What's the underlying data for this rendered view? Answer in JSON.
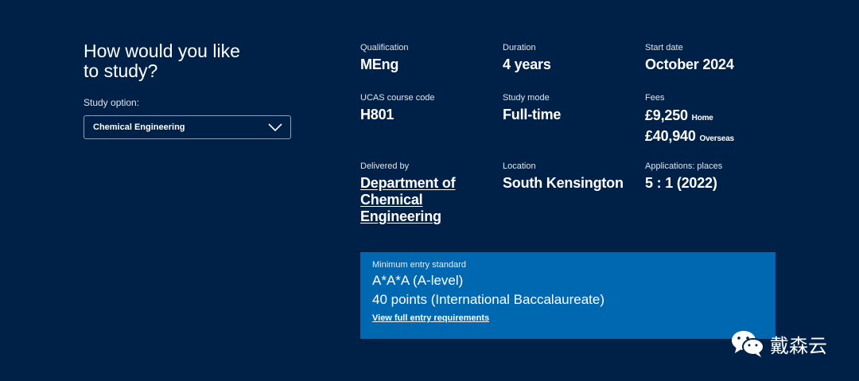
{
  "study": {
    "heading": "How would you like to study?",
    "option_label": "Study option:",
    "selected": "Chemical Engineering"
  },
  "details": {
    "qualification": {
      "label": "Qualification",
      "value": "MEng"
    },
    "duration": {
      "label": "Duration",
      "value": "4 years"
    },
    "start_date": {
      "label": "Start date",
      "value": "October 2024"
    },
    "ucas": {
      "label": "UCAS course code",
      "value": "H801"
    },
    "study_mode": {
      "label": "Study mode",
      "value": "Full-time"
    },
    "fees": {
      "label": "Fees",
      "home_amount": "£9,250",
      "home_label": "Home",
      "overseas_amount": "£40,940",
      "overseas_label": "Overseas"
    },
    "delivered_by": {
      "label": "Delivered by",
      "value": "Department of Chemical Engineering"
    },
    "location": {
      "label": "Location",
      "value": "South Kensington"
    },
    "applications": {
      "label": "Applications: places",
      "value": "5 : 1 (2022)"
    }
  },
  "entry": {
    "label": "Minimum entry standard",
    "line1": "A*A*A (A-level)",
    "line2": "40 points (International Baccalaureate)",
    "link": "View full entry requirements"
  },
  "watermark": {
    "text": "戴森云"
  },
  "colors": {
    "background": "#002147",
    "entry_box": "#0068b0"
  }
}
